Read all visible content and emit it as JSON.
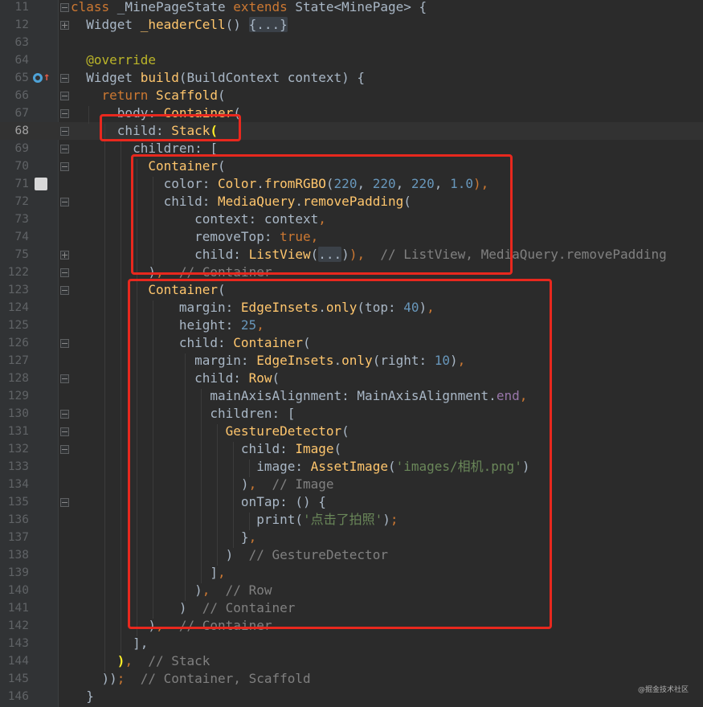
{
  "lines": [
    {
      "n": "11",
      "fold": "minus",
      "current": false,
      "tokens": [
        [
          "kw",
          "class "
        ],
        [
          "",
          "_MinePageState "
        ],
        [
          "kw",
          "extends "
        ],
        [
          "",
          "State<MinePage> {"
        ]
      ]
    },
    {
      "n": "12",
      "fold": "plus",
      "current": false,
      "tokens": [
        [
          "",
          "  Widget "
        ],
        [
          "cls",
          "_headerCell"
        ],
        [
          "",
          "() "
        ],
        [
          "ellipsis",
          "{...}"
        ]
      ]
    },
    {
      "n": "63",
      "fold": "",
      "current": false,
      "tokens": []
    },
    {
      "n": "64",
      "fold": "",
      "current": false,
      "tokens": [
        [
          "ann",
          "  @override"
        ]
      ]
    },
    {
      "n": "65",
      "fold": "minus",
      "current": false,
      "tokens": [
        [
          "",
          "  Widget "
        ],
        [
          "cls",
          "build"
        ],
        [
          "",
          "(BuildContext context) {"
        ]
      ]
    },
    {
      "n": "66",
      "fold": "minus",
      "current": false,
      "tokens": [
        [
          "kw",
          "    return "
        ],
        [
          "cls",
          "Scaffold"
        ],
        [
          "",
          "("
        ]
      ]
    },
    {
      "n": "67",
      "fold": "minus",
      "current": false,
      "tokens": [
        [
          "",
          "      body: "
        ],
        [
          "cls",
          "Container"
        ],
        [
          "",
          "("
        ]
      ]
    },
    {
      "n": "68",
      "fold": "minus",
      "current": true,
      "tokens": [
        [
          "",
          "      child: "
        ],
        [
          "cls",
          "Stack"
        ],
        [
          "brace",
          "("
        ]
      ]
    },
    {
      "n": "69",
      "fold": "minus",
      "current": false,
      "tokens": [
        [
          "",
          "        children: ["
        ]
      ]
    },
    {
      "n": "70",
      "fold": "minus",
      "current": false,
      "tokens": [
        [
          "cls",
          "          Container"
        ],
        [
          "",
          "("
        ]
      ]
    },
    {
      "n": "71",
      "fold": "",
      "current": false,
      "tokens": [
        [
          "",
          "            color: "
        ],
        [
          "cls",
          "Color"
        ],
        [
          "",
          "."
        ],
        [
          "cls",
          "fromRGBO"
        ],
        [
          "",
          "("
        ],
        [
          "num",
          "220"
        ],
        [
          "",
          ", "
        ],
        [
          "num",
          "220"
        ],
        [
          "",
          ", "
        ],
        [
          "num",
          "220"
        ],
        [
          "",
          ", "
        ],
        [
          "num",
          "1.0"
        ],
        [
          "kw",
          "),"
        ]
      ]
    },
    {
      "n": "72",
      "fold": "minus",
      "current": false,
      "tokens": [
        [
          "",
          "            child: "
        ],
        [
          "cls",
          "MediaQuery"
        ],
        [
          "",
          "."
        ],
        [
          "cls",
          "removePadding"
        ],
        [
          "",
          "("
        ]
      ]
    },
    {
      "n": "73",
      "fold": "",
      "current": false,
      "tokens": [
        [
          "",
          "                context: context"
        ],
        [
          "kw",
          ","
        ]
      ]
    },
    {
      "n": "74",
      "fold": "",
      "current": false,
      "tokens": [
        [
          "",
          "                removeTop: "
        ],
        [
          "kw",
          "true,"
        ]
      ]
    },
    {
      "n": "75",
      "fold": "plus",
      "current": false,
      "tokens": [
        [
          "",
          "                child: "
        ],
        [
          "cls",
          "ListView"
        ],
        [
          "",
          "("
        ],
        [
          "ellipsis",
          "..."
        ],
        [
          "",
          ")"
        ],
        [
          "kw",
          "),  "
        ],
        [
          "cmt",
          "// ListView, MediaQuery.removePadding"
        ]
      ]
    },
    {
      "n": "122",
      "fold": "minus",
      "current": false,
      "tokens": [
        [
          "",
          "          )"
        ],
        [
          "kw",
          ",  "
        ],
        [
          "cmt",
          "// Container"
        ]
      ]
    },
    {
      "n": "123",
      "fold": "minus",
      "current": false,
      "tokens": [
        [
          "cls",
          "          Container"
        ],
        [
          "",
          "("
        ]
      ]
    },
    {
      "n": "124",
      "fold": "",
      "current": false,
      "tokens": [
        [
          "",
          "              margin: "
        ],
        [
          "cls",
          "EdgeInsets"
        ],
        [
          "",
          "."
        ],
        [
          "cls",
          "only"
        ],
        [
          "",
          "(top: "
        ],
        [
          "num",
          "40"
        ],
        [
          "",
          ")"
        ],
        [
          "kw",
          ","
        ]
      ]
    },
    {
      "n": "125",
      "fold": "",
      "current": false,
      "tokens": [
        [
          "",
          "              height: "
        ],
        [
          "num",
          "25"
        ],
        [
          "kw",
          ","
        ]
      ]
    },
    {
      "n": "126",
      "fold": "minus",
      "current": false,
      "tokens": [
        [
          "",
          "              child: "
        ],
        [
          "cls",
          "Container"
        ],
        [
          "",
          "("
        ]
      ]
    },
    {
      "n": "127",
      "fold": "",
      "current": false,
      "tokens": [
        [
          "",
          "                margin: "
        ],
        [
          "cls",
          "EdgeInsets"
        ],
        [
          "",
          "."
        ],
        [
          "cls",
          "only"
        ],
        [
          "",
          "(right: "
        ],
        [
          "num",
          "10"
        ],
        [
          "",
          ")"
        ],
        [
          "kw",
          ","
        ]
      ]
    },
    {
      "n": "128",
      "fold": "minus",
      "current": false,
      "tokens": [
        [
          "",
          "                child: "
        ],
        [
          "cls",
          "Row"
        ],
        [
          "",
          "("
        ]
      ]
    },
    {
      "n": "129",
      "fold": "",
      "current": false,
      "tokens": [
        [
          "",
          "                  mainAxisAlignment: MainAxisAlignment."
        ],
        [
          "prop",
          "end"
        ],
        [
          "kw",
          ","
        ]
      ]
    },
    {
      "n": "130",
      "fold": "minus",
      "current": false,
      "tokens": [
        [
          "",
          "                  children: ["
        ]
      ]
    },
    {
      "n": "131",
      "fold": "minus",
      "current": false,
      "tokens": [
        [
          "cls",
          "                    GestureDetector"
        ],
        [
          "",
          "("
        ]
      ]
    },
    {
      "n": "132",
      "fold": "minus",
      "current": false,
      "tokens": [
        [
          "",
          "                      child: "
        ],
        [
          "cls",
          "Image"
        ],
        [
          "",
          "("
        ]
      ]
    },
    {
      "n": "133",
      "fold": "",
      "current": false,
      "tokens": [
        [
          "",
          "                        image: "
        ],
        [
          "cls",
          "AssetImage"
        ],
        [
          "",
          "("
        ],
        [
          "str",
          "'images/相机.png'"
        ],
        [
          "",
          ")"
        ]
      ]
    },
    {
      "n": "134",
      "fold": "",
      "current": false,
      "tokens": [
        [
          "",
          "                      )"
        ],
        [
          "kw",
          ",  "
        ],
        [
          "cmt",
          "// Image"
        ]
      ]
    },
    {
      "n": "135",
      "fold": "minus",
      "current": false,
      "tokens": [
        [
          "",
          "                      onTap: () {"
        ]
      ]
    },
    {
      "n": "136",
      "fold": "",
      "current": false,
      "tokens": [
        [
          "",
          "                        print("
        ],
        [
          "str",
          "'点击了拍照'"
        ],
        [
          "",
          ")"
        ],
        [
          "kw",
          ";"
        ]
      ]
    },
    {
      "n": "137",
      "fold": "",
      "current": false,
      "tokens": [
        [
          "",
          "                      }"
        ],
        [
          "kw",
          ","
        ]
      ]
    },
    {
      "n": "138",
      "fold": "",
      "current": false,
      "tokens": [
        [
          "",
          "                    )  "
        ],
        [
          "cmt",
          "// GestureDetector"
        ]
      ]
    },
    {
      "n": "139",
      "fold": "",
      "current": false,
      "tokens": [
        [
          "",
          "                  ]"
        ],
        [
          "kw",
          ","
        ]
      ]
    },
    {
      "n": "140",
      "fold": "",
      "current": false,
      "tokens": [
        [
          "",
          "                )"
        ],
        [
          "kw",
          ",  "
        ],
        [
          "cmt",
          "// Row"
        ]
      ]
    },
    {
      "n": "141",
      "fold": "",
      "current": false,
      "tokens": [
        [
          "",
          "              )  "
        ],
        [
          "cmt",
          "// Container"
        ]
      ]
    },
    {
      "n": "142",
      "fold": "",
      "current": false,
      "tokens": [
        [
          "",
          "          )"
        ],
        [
          "kw",
          ",  "
        ],
        [
          "cmt",
          "// Container"
        ]
      ]
    },
    {
      "n": "143",
      "fold": "",
      "current": false,
      "tokens": [
        [
          "",
          "        ],"
        ]
      ]
    },
    {
      "n": "144",
      "fold": "",
      "current": false,
      "tokens": [
        [
          "brace",
          "      )"
        ],
        [
          "kw",
          ",  "
        ],
        [
          "cmt",
          "// Stack"
        ]
      ]
    },
    {
      "n": "145",
      "fold": "",
      "current": false,
      "tokens": [
        [
          "",
          "    ))"
        ],
        [
          "kw",
          ";  "
        ],
        [
          "cmt",
          "// Container, Scaffold"
        ]
      ]
    },
    {
      "n": "146",
      "fold": "",
      "current": false,
      "tokens": [
        [
          "",
          "  }"
        ]
      ]
    }
  ],
  "watermark": "@掘金技术社区",
  "colors": {
    "background": "#2b2b2b",
    "highlight_box": "#e8281e",
    "keyword": "#cc7832",
    "function": "#ffc66d",
    "number": "#6897bb",
    "string": "#6a8759",
    "comment": "#808080"
  }
}
